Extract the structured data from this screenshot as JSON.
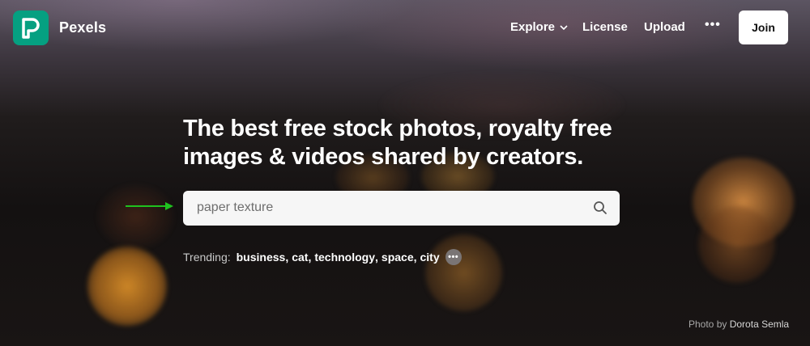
{
  "brand": {
    "name": "Pexels"
  },
  "nav": {
    "explore_label": "Explore",
    "license_label": "License",
    "upload_label": "Upload",
    "more_label": "•••",
    "join_label": "Join"
  },
  "hero": {
    "headline_line1": "The best free stock photos, royalty free",
    "headline_line2": "images & videos shared by creators."
  },
  "search": {
    "value": "paper texture",
    "icon": "search-icon"
  },
  "trending": {
    "label": "Trending:",
    "items": [
      "business",
      "cat",
      "technology",
      "space",
      "city"
    ],
    "more_label": "•••"
  },
  "credit": {
    "prefix": "Photo by",
    "author": "Dorota Semla"
  },
  "colors": {
    "brand_green": "#05a081",
    "annotation_arrow": "#1fc21f"
  }
}
